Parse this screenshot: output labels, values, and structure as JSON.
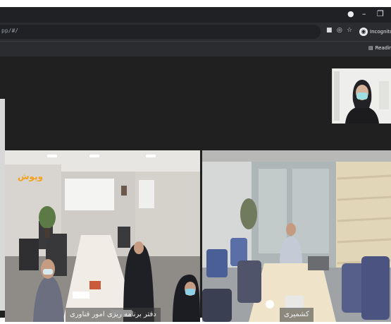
{
  "browser": {
    "url": "pp/#/",
    "profile_label": "Incognito",
    "reading_list_label": "Reading",
    "window_controls": [
      "record-dot-icon",
      "minimize-icon",
      "restore-icon"
    ],
    "toolbar_icons": [
      "camera-icon",
      "no-tracking-icon",
      "star-icon"
    ]
  },
  "meeting": {
    "self_view": {
      "icon": "participant-face-masked"
    },
    "tiles": [
      {
        "name_label": "دفتر برنامه ریزی امور فناوری",
        "logo_text": "وپوش"
      },
      {
        "name_label": "کشمیری"
      }
    ]
  },
  "colors": {
    "chrome_dark": "#202124",
    "toolbar": "#2b2c2f",
    "meeting_bg": "#202020",
    "logo_orange": "#f3a21b"
  }
}
